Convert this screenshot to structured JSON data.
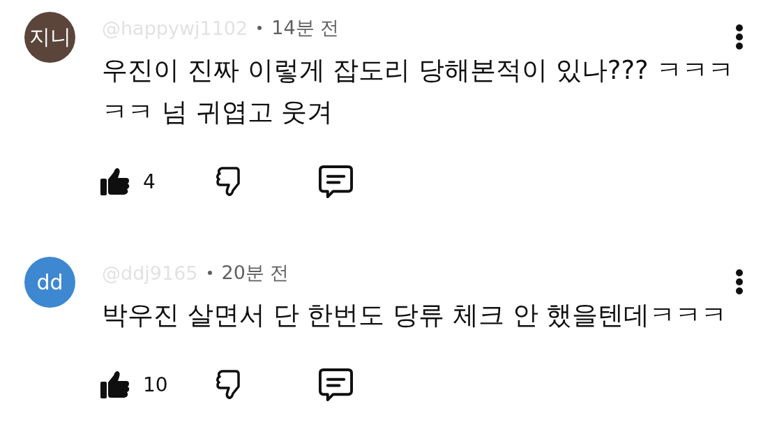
{
  "comments": [
    {
      "avatar": {
        "initials": "지니",
        "color": "#5b453b"
      },
      "handle": "@happywj1102",
      "time": "14분 전",
      "text": "우진이 진짜 이렇게 잡도리 당해본적이 있나??? ㅋㅋㅋㅋㅋ 넘 귀엽고 웃겨",
      "likes": "4",
      "liked": true,
      "disliked": false
    },
    {
      "avatar": {
        "initials": "dd",
        "color": "#3e87d1"
      },
      "handle": "@ddj9165",
      "time": "20분 전",
      "text": "박우진 살면서 단 한번도 당류 체크 안 했을텐데ㅋㅋㅋ",
      "likes": "10",
      "liked": true,
      "disliked": false
    }
  ]
}
